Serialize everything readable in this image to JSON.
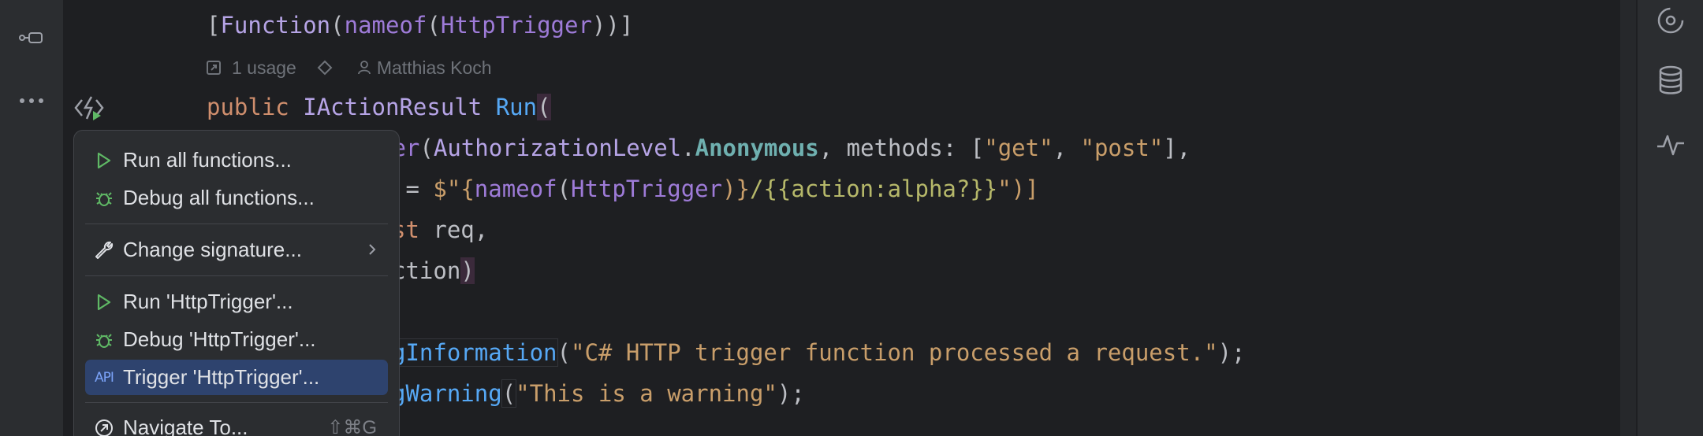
{
  "code": {
    "attr_line": [
      "[",
      "Function",
      "(",
      "nameof",
      "(",
      "HttpTrigger",
      "))]"
    ],
    "method_line": [
      "public",
      " ",
      "IActionResult",
      " ",
      "Run",
      "("
    ],
    "line3": {
      "a": "ger",
      "b": "(",
      "c": "AuthorizationLevel",
      "d": ".",
      "e": "Anonymous",
      "f": ", methods: [",
      "g": "\"get\"",
      "h": ", ",
      "i": "\"post\"",
      "j": "],"
    },
    "line4": {
      "a": " = ",
      "b": "$\"",
      "c": "{",
      "d": "nameof",
      "e": "(",
      "f": "HttpTrigger",
      "g": ")}",
      "h": "/{{action:alpha?}}",
      "i": "\")]"
    },
    "line5": {
      "a": "st",
      "b": " req,"
    },
    "line6": {
      "a": "ction",
      "b": ")"
    },
    "line7": {
      "a": "gInformation",
      "b": "(",
      "c": "\"C# HTTP trigger function processed a request.\"",
      "d": ");"
    },
    "line8": {
      "a": "gWarning",
      "b": "(",
      "c": "\"This is a warning\"",
      "d": ");"
    }
  },
  "hints": {
    "usages": "1 usage",
    "author": "Matthias Koch"
  },
  "context_menu": {
    "items": [
      {
        "icon": "run-icon",
        "label": "Run all functions..."
      },
      {
        "icon": "debug-icon",
        "label": "Debug all functions..."
      },
      {
        "icon": "wrench-icon",
        "label": "Change signature...",
        "submenu": true
      },
      {
        "icon": "run-icon",
        "label": "Run 'HttpTrigger'..."
      },
      {
        "icon": "debug-icon",
        "label": "Debug 'HttpTrigger'..."
      },
      {
        "icon": "api-icon",
        "label": "Trigger 'HttpTrigger'...",
        "selected": true,
        "badge": "API"
      },
      {
        "icon": "navigate-icon",
        "label": "Navigate To...",
        "shortcut": "⇧⌘G"
      }
    ]
  },
  "colors": {
    "background": "#1e1f22",
    "menu_background": "#2b2d30",
    "selection": "#2e436e",
    "run_green": "#5fb865",
    "keyword": "#cf8e6d",
    "string": "#c99e6a"
  }
}
